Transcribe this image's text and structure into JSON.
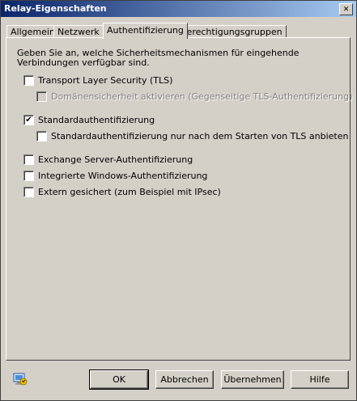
{
  "window": {
    "title": "Relay-Eigenschaften",
    "close_glyph": "✕"
  },
  "tabs": [
    {
      "label": "Allgemein",
      "active": false
    },
    {
      "label": "Netzwerk",
      "active": false
    },
    {
      "label": "Authentifizierung",
      "active": true
    },
    {
      "label": "Berechtigungsgruppen",
      "active": false
    }
  ],
  "intro": "Geben Sie an, welche Sicherheitsmechanismen für eingehende Verbindungen verfügbar sind.",
  "options": {
    "tls": {
      "label": "Transport Layer Security (TLS)",
      "checked": false,
      "enabled": true
    },
    "domain_security": {
      "label": "Domänensicherheit aktivieren (Gegenseitige TLS-Authentifizierung)",
      "checked": false,
      "enabled": false
    },
    "basic_auth": {
      "label": "Standardauthentifizierung",
      "checked": true,
      "enabled": true
    },
    "basic_after_tls": {
      "label": "Standardauthentifizierung nur nach dem Starten von TLS anbieten",
      "checked": false,
      "enabled": true
    },
    "exchange_auth": {
      "label": "Exchange Server-Authentifizierung",
      "checked": false,
      "enabled": true
    },
    "windows_auth": {
      "label": "Integrierte Windows-Authentifizierung",
      "checked": false,
      "enabled": true
    },
    "external_secured": {
      "label": "Extern gesichert (zum Beispiel mit IPsec)",
      "checked": false,
      "enabled": true
    }
  },
  "checkmark": "✔",
  "buttons": {
    "ok": "OK",
    "cancel": "Abbrechen",
    "apply": "Übernehmen",
    "help": "Hilfe"
  },
  "icons": {
    "help_icon": "computer-help-icon"
  }
}
